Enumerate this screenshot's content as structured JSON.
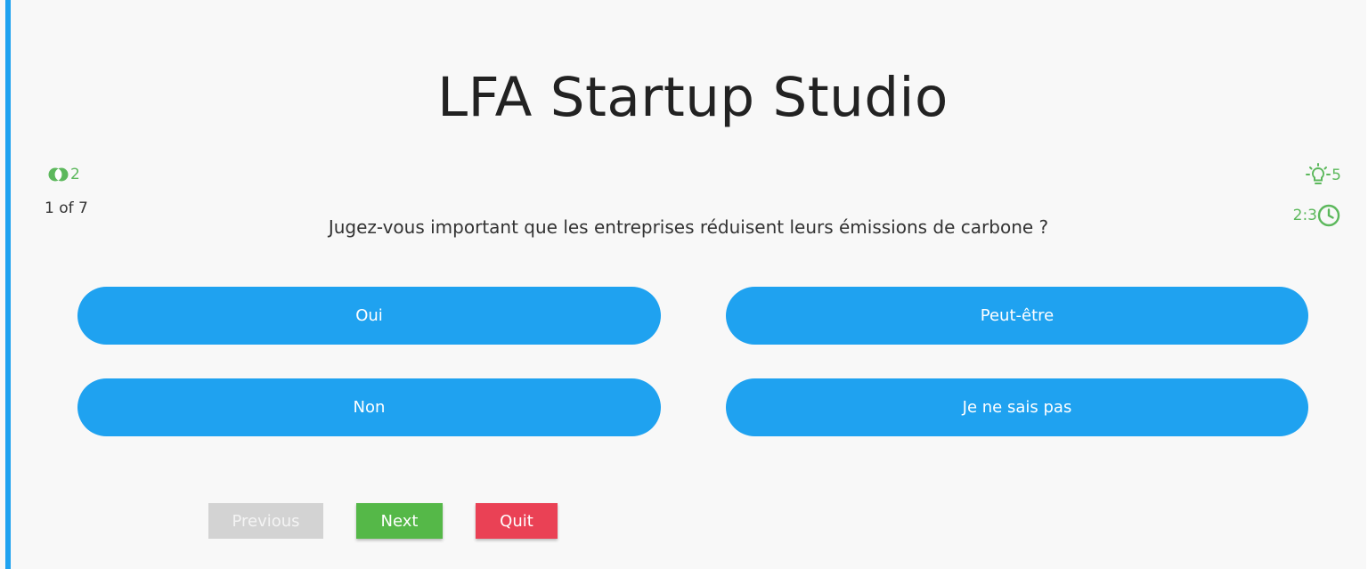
{
  "app": {
    "title": "LFA Startup Studio"
  },
  "stats": {
    "fifty_fifty_count": "2",
    "fifty_fifty_icon": "fifty-fifty-icon",
    "progress": "1 of 7",
    "hints_count": "5",
    "hints_icon": "lightbulb-icon",
    "timer": "2:3",
    "timer_icon": "clock-icon"
  },
  "question": {
    "text": "Jugez-vous important que les entreprises réduisent leurs émissions de carbone ?",
    "options": [
      {
        "label": "Oui"
      },
      {
        "label": "Peut-être"
      },
      {
        "label": "Non"
      },
      {
        "label": "Je ne sais pas"
      }
    ]
  },
  "controls": {
    "previous_label": "Previous",
    "next_label": "Next",
    "quit_label": "Quit"
  },
  "colors": {
    "accent": "#1fa2f0",
    "success": "#55b848",
    "danger": "#ea4155",
    "disabled": "#d3d3d3",
    "stats_green": "#5cb85c"
  }
}
